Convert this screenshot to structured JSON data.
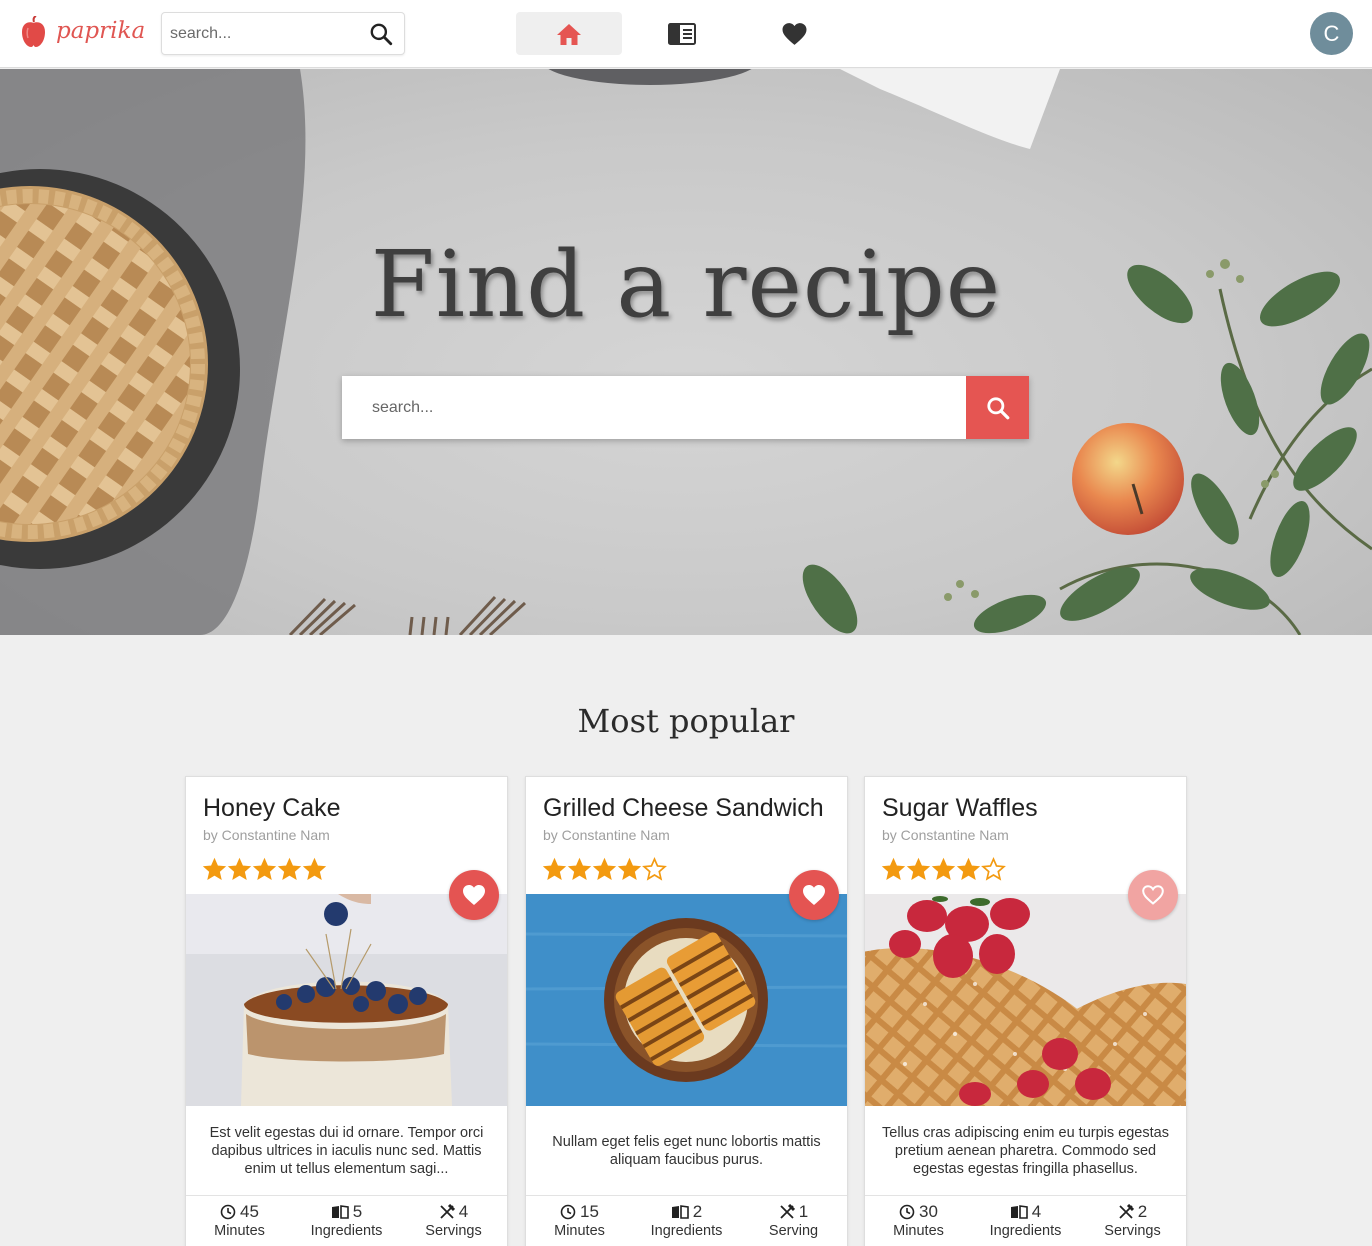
{
  "brand": {
    "name": "paprika",
    "logo_icon": "pepper-icon",
    "accent_color": "#e55552"
  },
  "topbar": {
    "search_placeholder": "search...",
    "search_icon": "search-icon",
    "nav": [
      {
        "name": "home",
        "icon": "home-icon",
        "active": true
      },
      {
        "name": "recipes",
        "icon": "book-icon",
        "active": false
      },
      {
        "name": "favorites",
        "icon": "heart-icon",
        "active": false
      }
    ],
    "avatar_initial": "C"
  },
  "hero": {
    "title": "Find a recipe",
    "search_placeholder": "search...",
    "search_button_icon": "search-icon"
  },
  "popular": {
    "title": "Most popular",
    "cards": [
      {
        "title": "Honey Cake",
        "author": "by Constantine Nam",
        "rating": 5,
        "favorited": true,
        "description": "Est velit egestas dui id ornare. Tempor orci dapibus ultrices in iaculis nunc sed. Mattis enim ut tellus elementum sagi...",
        "minutes": "45",
        "minutes_label": "Minutes",
        "ingredients": "5",
        "ingredients_label": "Ingredients",
        "servings": "4",
        "servings_label": "Servings"
      },
      {
        "title": "Grilled Cheese Sandwich",
        "author": "by Constantine Nam",
        "rating": 4,
        "favorited": true,
        "description": "Nullam eget felis eget nunc lobortis mattis aliquam faucibus purus.",
        "minutes": "15",
        "minutes_label": "Minutes",
        "ingredients": "2",
        "ingredients_label": "Ingredients",
        "servings": "1",
        "servings_label": "Serving"
      },
      {
        "title": "Sugar Waffles",
        "author": "by Constantine Nam",
        "rating": 4,
        "favorited": false,
        "description": "Tellus cras adipiscing enim eu turpis egestas pretium aenean pharetra. Commodo sed egestas egestas fringilla phasellus.",
        "minutes": "30",
        "minutes_label": "Minutes",
        "ingredients": "4",
        "ingredients_label": "Ingredients",
        "servings": "2",
        "servings_label": "Servings"
      }
    ]
  },
  "colors": {
    "star": "#f39a10",
    "heart_active": "#e45452",
    "heart_inactive": "#f1a4a2",
    "avatar": "#6f8d9b"
  }
}
